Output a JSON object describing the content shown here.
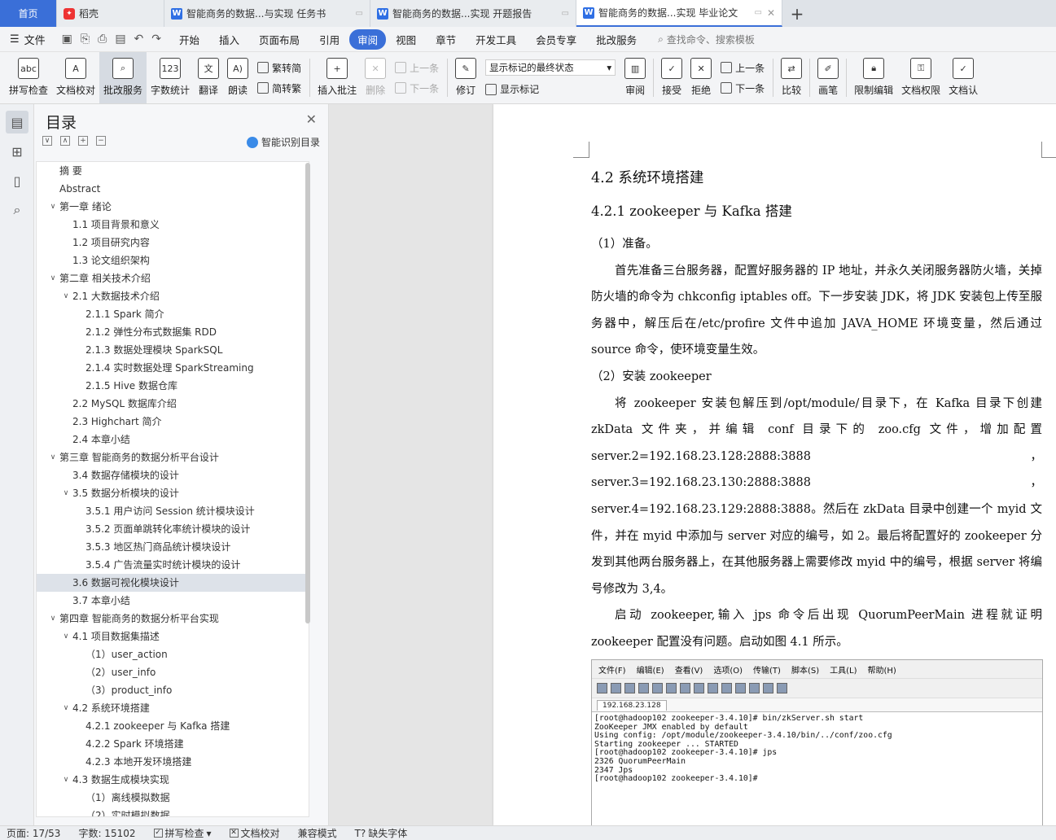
{
  "tabs": [
    {
      "label": "首页",
      "kind": "home"
    },
    {
      "label": "稻壳",
      "kind": "daoke"
    },
    {
      "label": "智能商务的数据...与实现 任务书",
      "kind": "doc"
    },
    {
      "label": "智能商务的数据...实现 开题报告",
      "kind": "doc"
    },
    {
      "label": "智能商务的数据...实现 毕业论文",
      "kind": "doc",
      "active": true
    }
  ],
  "menubar": {
    "file": "文件",
    "items": [
      "开始",
      "插入",
      "页面布局",
      "引用",
      "审阅",
      "视图",
      "章节",
      "开发工具",
      "会员专享",
      "批改服务"
    ],
    "active": "审阅",
    "search_placeholder": "查找命令、搜索模板"
  },
  "ribbon": {
    "spellcheck": "拼写检查",
    "proofread": "文档校对",
    "correction_service": "批改服务",
    "word_count": "字数统计",
    "translate": "翻译",
    "read_aloud": "朗读",
    "trad_to_simp": "繁转简",
    "simp_to_trad": "简转繁",
    "insert_comment": "插入批注",
    "delete": "删除",
    "prev": "上一条",
    "next": "下一条",
    "track_changes": "修订",
    "markup_dropdown": "显示标记的最终状态",
    "show_markup": "显示标记",
    "review": "审阅",
    "accept": "接受",
    "reject": "拒绝",
    "prev2": "上一条",
    "next2": "下一条",
    "compare": "比较",
    "pen": "画笔",
    "restrict_edit": "限制编辑",
    "doc_permission": "文档权限",
    "doc_cert": "文档认"
  },
  "toc": {
    "title": "目录",
    "ai_label": "智能识别目录",
    "items": [
      {
        "text": "摘  要",
        "level": 0,
        "arrow": ""
      },
      {
        "text": "Abstract",
        "level": 0,
        "arrow": ""
      },
      {
        "text": "第一章  绪论",
        "level": 0,
        "arrow": "v"
      },
      {
        "text": "1.1 项目背景和意义",
        "level": 1,
        "arrow": ""
      },
      {
        "text": "1.2 项目研究内容",
        "level": 1,
        "arrow": ""
      },
      {
        "text": "1.3 论文组织架构",
        "level": 1,
        "arrow": ""
      },
      {
        "text": "第二章  相关技术介绍",
        "level": 0,
        "arrow": "v"
      },
      {
        "text": "2.1 大数据技术介绍",
        "level": 1,
        "arrow": "v"
      },
      {
        "text": "2.1.1 Spark 简介",
        "level": 2,
        "arrow": ""
      },
      {
        "text": "2.1.2  弹性分布式数据集 RDD",
        "level": 2,
        "arrow": ""
      },
      {
        "text": "2.1.3 数据处理模块 SparkSQL",
        "level": 2,
        "arrow": ""
      },
      {
        "text": "2.1.4 实时数据处理 SparkStreaming",
        "level": 2,
        "arrow": ""
      },
      {
        "text": "2.1.5 Hive 数据仓库",
        "level": 2,
        "arrow": ""
      },
      {
        "text": "2.2 MySQL 数据库介绍",
        "level": 1,
        "arrow": ""
      },
      {
        "text": "2.3 Highchart 简介",
        "level": 1,
        "arrow": ""
      },
      {
        "text": "2.4  本章小结",
        "level": 1,
        "arrow": ""
      },
      {
        "text": "第三章  智能商务的数据分析平台设计",
        "level": 0,
        "arrow": "v"
      },
      {
        "text": "3.4 数据存储模块的设计",
        "level": 1,
        "arrow": ""
      },
      {
        "text": "3.5 数据分析模块的设计",
        "level": 1,
        "arrow": "v"
      },
      {
        "text": "3.5.1  用户访问 Session 统计模块设计",
        "level": 2,
        "arrow": ""
      },
      {
        "text": "3.5.2  页面单跳转化率统计模块的设计",
        "level": 2,
        "arrow": ""
      },
      {
        "text": "3.5.3  地区热门商品统计模块设计",
        "level": 2,
        "arrow": ""
      },
      {
        "text": "3.5.4 广告流量实时统计模块的设计",
        "level": 2,
        "arrow": ""
      },
      {
        "text": "3.6 数据可视化模块设计",
        "level": 1,
        "arrow": "",
        "selected": true
      },
      {
        "text": "3.7  本章小结",
        "level": 1,
        "arrow": ""
      },
      {
        "text": "第四章  智能商务的数据分析平台实现",
        "level": 0,
        "arrow": "v"
      },
      {
        "text": "4.1 项目数据集描述",
        "level": 1,
        "arrow": "v"
      },
      {
        "text": "（1）user_action",
        "level": 2,
        "arrow": ""
      },
      {
        "text": "（2）user_info",
        "level": 2,
        "arrow": ""
      },
      {
        "text": "（3）product_info",
        "level": 2,
        "arrow": ""
      },
      {
        "text": "4.2 系统环境搭建",
        "level": 1,
        "arrow": "v"
      },
      {
        "text": "4.2.1 zookeeper 与 Kafka 搭建",
        "level": 2,
        "arrow": ""
      },
      {
        "text": "4.2.2 Spark 环境搭建",
        "level": 2,
        "arrow": ""
      },
      {
        "text": "4.2.3 本地开发环境搭建",
        "level": 2,
        "arrow": ""
      },
      {
        "text": "4.3 数据生成模块实现",
        "level": 1,
        "arrow": "v"
      },
      {
        "text": "（1）离线模拟数据",
        "level": 2,
        "arrow": ""
      },
      {
        "text": "（2）实时模拟数据",
        "level": 2,
        "arrow": ""
      }
    ]
  },
  "document": {
    "h2": "4.2 系统环境搭建",
    "h3": "4.2.1 zookeeper 与 Kafka 搭建",
    "step1": "（1）准备。",
    "para1": "首先准备三台服务器，配置好服务器的 IP 地址，并永久关闭服务器防火墙，关掉防火墙的命令为  chkconfig iptables off。下一步安装 JDK，将 JDK 安装包上传至服务器中，解压后在/etc/profire 文件中追加 JAVA_HOME 环境变量，然后通过 source 命令，使环境变量生效。",
    "step2": "（2）安装 zookeeper",
    "para2": "将 zookeeper 安装包解压到/opt/module/目录下，在 Kafka 目录下创建 zkData 文件夹，并编辑 conf 目录下的 zoo.cfg 文件，增加配置 server.2=192.168.23.128:2888:3888，server.3=192.168.23.130:2888:3888，server.4=192.168.23.129:2888:3888。然后在 zkData 目录中创建一个 myid 文件，并在 myid 中添加与 server 对应的编号，如 2。最后将配置好的 zookeeper 分发到其他两台服务器上，在其他服务器上需要修改 myid 中的编号，根据 server 将编号修改为 3,4。",
    "para3": "启动 zookeeper,输入 jps 命令后出现 QuorumPeerMain 进程就证明 zookeeper 配置没有问题。启动如图 4.1 所示。"
  },
  "terminal": {
    "menu": [
      "文件(F)",
      "编辑(E)",
      "查看(V)",
      "选项(O)",
      "传输(T)",
      "脚本(S)",
      "工具(L)",
      "帮助(H)"
    ],
    "tab": "192.168.23.128",
    "lines": [
      "[root@hadoop102 zookeeper-3.4.10]# bin/zkServer.sh start",
      "ZooKeeper JMX enabled by default",
      "Using config: /opt/module/zookeeper-3.4.10/bin/../conf/zoo.cfg",
      "Starting zookeeper ... STARTED",
      "[root@hadoop102 zookeeper-3.4.10]# jps",
      "2326 QuorumPeerMain",
      "2347 Jps",
      "[root@hadoop102 zookeeper-3.4.10]#"
    ]
  },
  "status": {
    "page": "页面: 17/53",
    "words": "字数: 15102",
    "spell": "拼写检查",
    "proof": "文档校对",
    "compat": "兼容模式",
    "missing_font": "缺失字体"
  },
  "colors": {
    "accent": "#3a6fd8",
    "wavy": "#dd3333"
  }
}
